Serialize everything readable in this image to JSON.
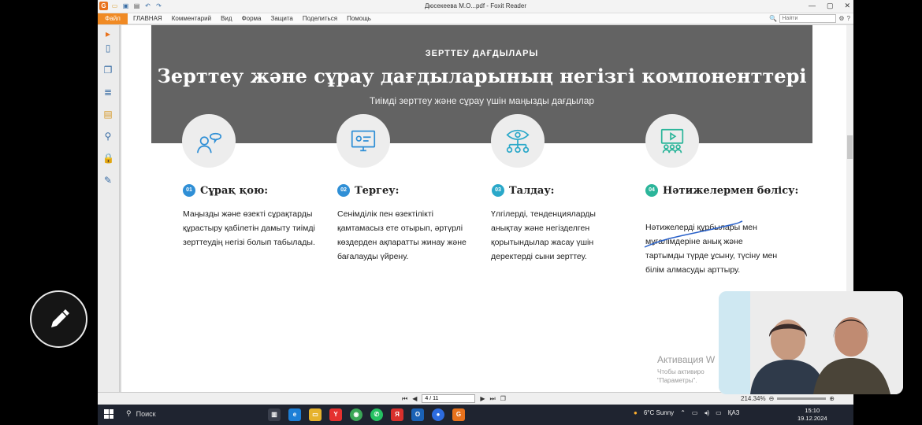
{
  "window": {
    "title": "Дюсекеева М.О...pdf - Foxit Reader",
    "app_logo": "G"
  },
  "menu": {
    "file": "Файл",
    "items": [
      "ГЛАВНАЯ",
      "Комментарий",
      "Вид",
      "Форма",
      "Защита",
      "Поделиться",
      "Помощь"
    ],
    "search_placeholder": "Найти"
  },
  "document": {
    "eyebrow": "ЗЕРТТЕУ ДАҒДЫЛАРЫ",
    "title": "Зерттеу және сұрау дағдыларының негізгі компоненттері",
    "subtitle": "Тиімді зерттеу және сұрау үшін маңызды дағдылар",
    "cards": [
      {
        "num": "01",
        "title": "Сұрақ қою:",
        "body": "Маңызды және өзекті сұрақтарды құрастыру қабілетін дамыту тиімді зерттеудің негізі болып табылады.",
        "color": "#2f8fd6",
        "icon": "question-person-icon"
      },
      {
        "num": "02",
        "title": "Тергеу:",
        "body": "Сенімділік пен өзектілікті қамтамасыз ете отырып, әртүрлі көздерден ақпаратты жинау және бағалауды үйрену.",
        "color": "#2f8fd6",
        "icon": "monitor-research-icon"
      },
      {
        "num": "03",
        "title": "Талдау:",
        "body": "Үлгілерді, тенденцияларды анықтау және негізделген қорытындылар жасау үшін деректерді сыни зерттеу.",
        "color": "#2aa8c9",
        "icon": "eye-network-icon"
      },
      {
        "num": "04",
        "title": "Нәтижелермен бөлісу:",
        "body": "Нәтижелерді құрбылары мен мұғалімдеріне анық және тартымды түрде ұсыну, түсіну мен білім алмасуды арттыру.",
        "color": "#2bb59a",
        "icon": "presentation-icon"
      }
    ]
  },
  "activation": {
    "title": "Активация W",
    "line1": "Чтобы активиро",
    "line2": "\"Параметры\"."
  },
  "status": {
    "page": "4 / 11",
    "zoom": "214.34%"
  },
  "taskbar": {
    "search": "Поиск",
    "weather": "6°C Sunny",
    "lang": "ҚАЗ",
    "time": "15:10",
    "date": "19.12.2024"
  }
}
